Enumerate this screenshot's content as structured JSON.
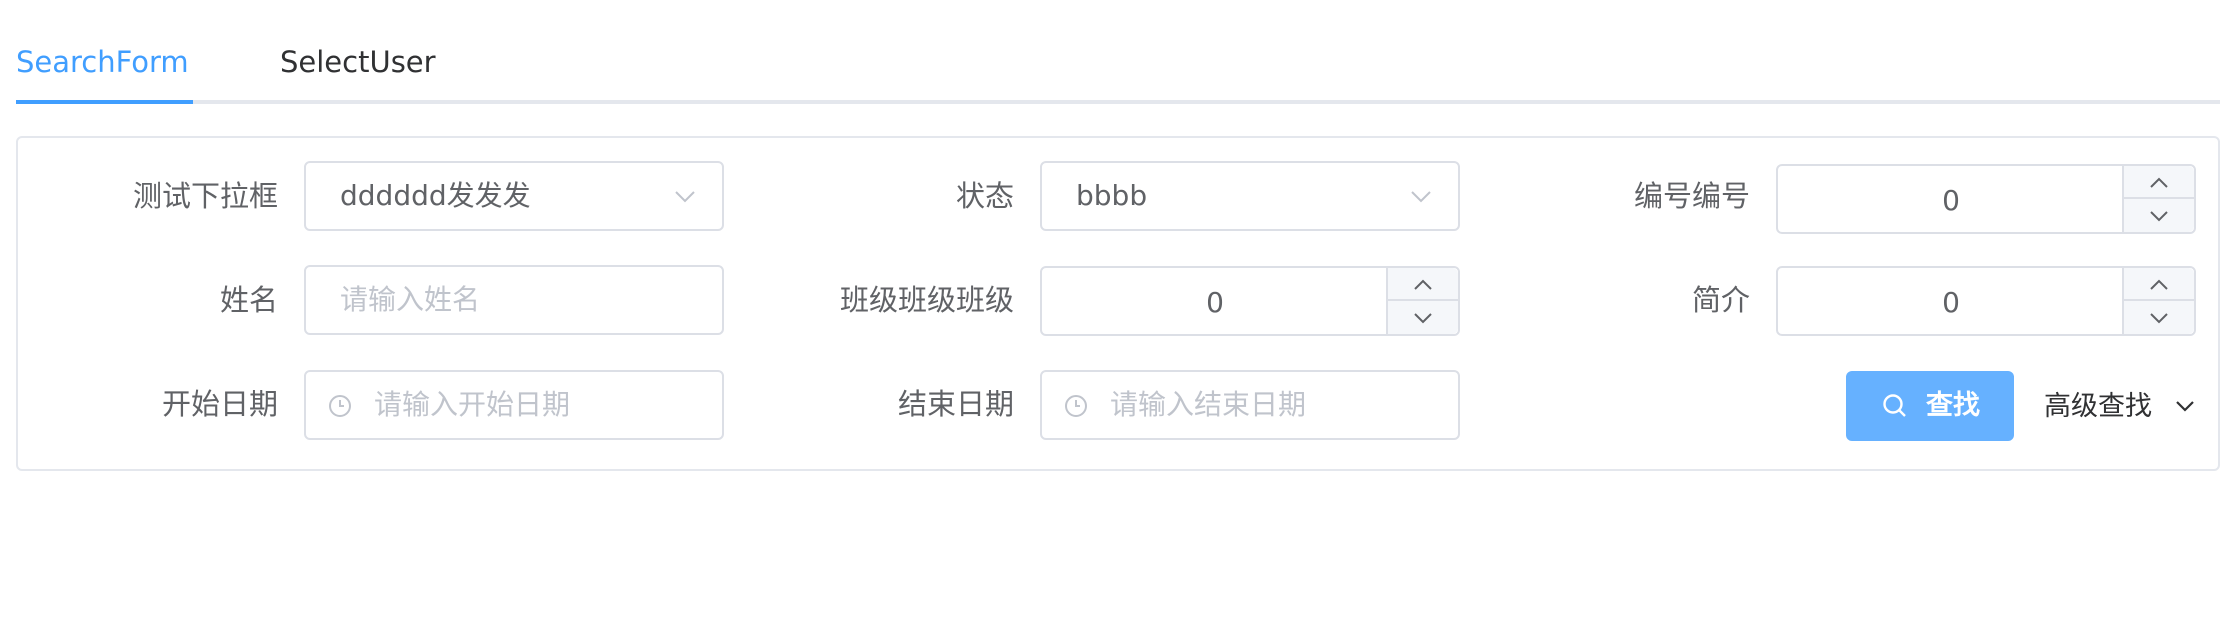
{
  "tabs": [
    {
      "label": "SearchForm",
      "active": true
    },
    {
      "label": "SelectUser",
      "active": false
    }
  ],
  "form": {
    "select_test": {
      "label": "测试下拉框",
      "value": "dddddd发发发"
    },
    "status": {
      "label": "状态",
      "value": "bbbb"
    },
    "number": {
      "label": "编号编号",
      "value": "0"
    },
    "name": {
      "label": "姓名",
      "placeholder": "请输入姓名"
    },
    "class": {
      "label": "班级班级班级",
      "value": "0"
    },
    "intro": {
      "label": "简介",
      "value": "0"
    },
    "start_date": {
      "label": "开始日期",
      "placeholder": "请输入开始日期"
    },
    "end_date": {
      "label": "结束日期",
      "placeholder": "请输入结束日期"
    }
  },
  "actions": {
    "search_label": "查找",
    "advanced_label": "高级查找"
  },
  "colors": {
    "accent": "#409eff",
    "button": "#66b1ff",
    "border": "#dcdfe6"
  },
  "icons": [
    "chevron-down-icon",
    "chevron-up-icon",
    "clock-icon",
    "search-icon"
  ]
}
